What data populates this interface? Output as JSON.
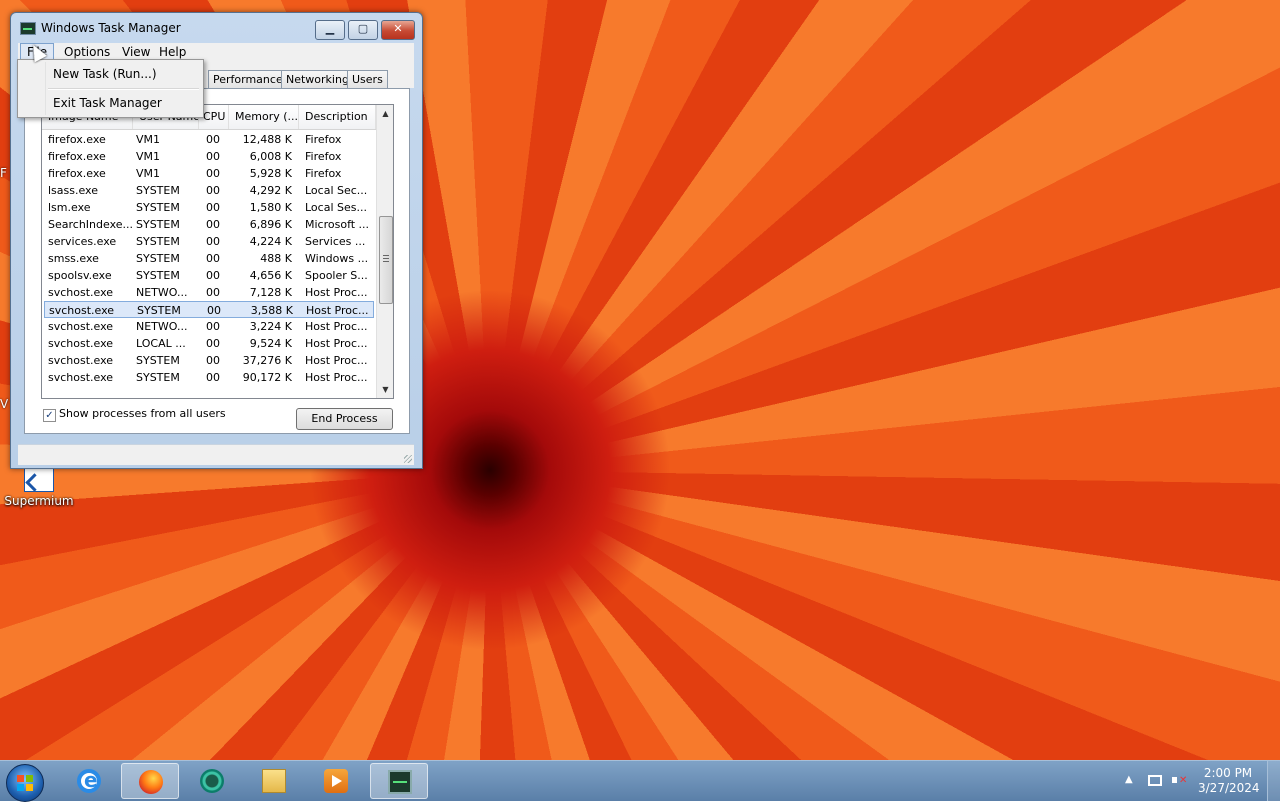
{
  "window": {
    "title": "Windows Task Manager",
    "menu": [
      "File",
      "Options",
      "View",
      "Help"
    ],
    "tabs": [
      "Performance",
      "Networking",
      "Users"
    ],
    "columns": [
      "Image Name",
      "User Name",
      "CPU",
      "Memory (...",
      "Description"
    ],
    "processes": [
      {
        "name": "firefox.exe",
        "user": "VM1",
        "cpu": "00",
        "mem": "12,488 K",
        "desc": "Firefox"
      },
      {
        "name": "firefox.exe",
        "user": "VM1",
        "cpu": "00",
        "mem": "6,008 K",
        "desc": "Firefox"
      },
      {
        "name": "firefox.exe",
        "user": "VM1",
        "cpu": "00",
        "mem": "5,928 K",
        "desc": "Firefox"
      },
      {
        "name": "lsass.exe",
        "user": "SYSTEM",
        "cpu": "00",
        "mem": "4,292 K",
        "desc": "Local Sec..."
      },
      {
        "name": "lsm.exe",
        "user": "SYSTEM",
        "cpu": "00",
        "mem": "1,580 K",
        "desc": "Local Ses..."
      },
      {
        "name": "SearchIndexe...",
        "user": "SYSTEM",
        "cpu": "00",
        "mem": "6,896 K",
        "desc": "Microsoft ..."
      },
      {
        "name": "services.exe",
        "user": "SYSTEM",
        "cpu": "00",
        "mem": "4,224 K",
        "desc": "Services ..."
      },
      {
        "name": "smss.exe",
        "user": "SYSTEM",
        "cpu": "00",
        "mem": "488 K",
        "desc": "Windows ..."
      },
      {
        "name": "spoolsv.exe",
        "user": "SYSTEM",
        "cpu": "00",
        "mem": "4,656 K",
        "desc": "Spooler S..."
      },
      {
        "name": "svchost.exe",
        "user": "NETWO...",
        "cpu": "00",
        "mem": "7,128 K",
        "desc": "Host Proc..."
      },
      {
        "name": "svchost.exe",
        "user": "SYSTEM",
        "cpu": "00",
        "mem": "3,588 K",
        "desc": "Host Proc...",
        "selected": true
      },
      {
        "name": "svchost.exe",
        "user": "NETWO...",
        "cpu": "00",
        "mem": "3,224 K",
        "desc": "Host Proc..."
      },
      {
        "name": "svchost.exe",
        "user": "LOCAL ...",
        "cpu": "00",
        "mem": "9,524 K",
        "desc": "Host Proc..."
      },
      {
        "name": "svchost.exe",
        "user": "SYSTEM",
        "cpu": "00",
        "mem": "37,276 K",
        "desc": "Host Proc..."
      },
      {
        "name": "svchost.exe",
        "user": "SYSTEM",
        "cpu": "00",
        "mem": "90,172 K",
        "desc": "Host Proc..."
      }
    ],
    "show_all_label": "Show processes from all users",
    "show_all_checked": true,
    "end_process_label": "End Process"
  },
  "file_menu": {
    "items": [
      "New Task (Run...)",
      "Exit Task Manager"
    ]
  },
  "desktop": {
    "icon_label": "Supermium",
    "edge_fragments": [
      "F",
      "V"
    ]
  },
  "taskbar": {
    "apps": [
      "internet-explorer-icon",
      "firefox-icon",
      "supermium-icon",
      "folder-icon",
      "media-player-icon",
      "task-manager-icon"
    ],
    "active_app": "task-manager-icon",
    "clock_time": "2:00 PM",
    "clock_date": "3/27/2024"
  }
}
